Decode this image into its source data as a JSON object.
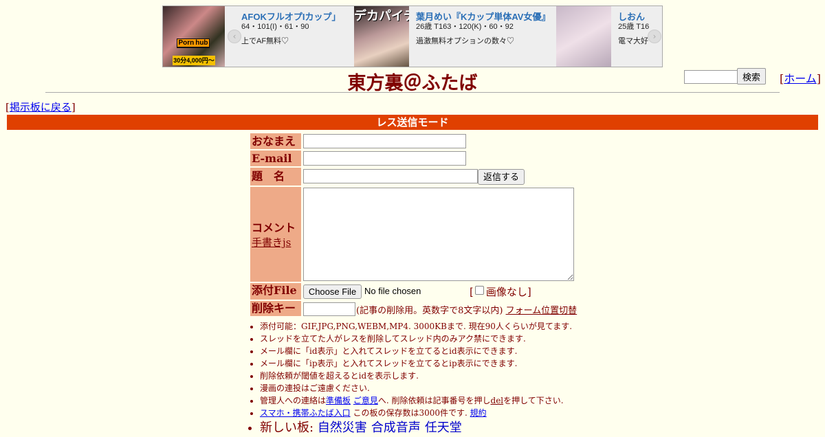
{
  "ad": {
    "left_thumb": {
      "badge": "30分4,000円〜",
      "brand_a": "Porn",
      "brand_b": "hub"
    },
    "prev_label": "‹",
    "next_label": "›",
    "cards": [
      {
        "title": "AFOKフルオプIカップ」",
        "spec": "64・101(I)・61・90",
        "desc": "上でAF無料♡"
      },
      {
        "title": "葉月めい『Kカップ単体AV女優』",
        "spec": "26歳 T163・120(K)・60・92",
        "desc": "過激無料オプションの数々♡"
      },
      {
        "title": "しおん",
        "spec": "25歳 T16",
        "desc": "電マ大好"
      }
    ],
    "mid_thumb_text": "デカパイデカ"
  },
  "header": {
    "logo": "東方裏＠ふたば",
    "search_button": "検索",
    "home_link": "ホーム",
    "back_link": "掲示板に戻る"
  },
  "mode_bar": "レス送信モード",
  "form": {
    "name_label": "おなまえ",
    "email_label": "E-mail",
    "subject_label": "題　名",
    "submit_button": "返信する",
    "comment_label": "コメント",
    "handwrite_link": "手書きjs",
    "file_label": "添付File",
    "file_button": "Choose File",
    "file_status": "No file chosen",
    "no_image_label": "画像なし",
    "delkey_label": "削除キー",
    "delkey_note": "(記事の削除用。英数字で8文字以内)",
    "form_toggle_link": "フォーム位置切替"
  },
  "rules": {
    "r1": "添付可能：GIF,JPG,PNG,WEBM,MP4. 3000KBまで. 現在90人くらいが見てます.",
    "r2": "スレッドを立てた人がレスを削除してスレッド内のみアク禁にできます.",
    "r3": "メール欄に「id表示」と入れてスレッドを立てるとid表示にできます.",
    "r4": "メール欄に「ip表示」と入れてスレッドを立てるとip表示にできます.",
    "r5": "削除依頼が閾値を超えるとidを表示します.",
    "r6": "漫画の連投はご遠慮ください.",
    "r7_a": "管理人への連絡は",
    "r7_link1": "準備板",
    "r7_link2": "ご意見",
    "r7_b": "へ. 削除依頼は記事番号を押し",
    "r7_link3": "del",
    "r7_c": "を押して下さい.",
    "r8_link1": "スマホ・携帯ふたば入口",
    "r8_b": "この板の保存数は3000件です.",
    "r8_link2": "規約",
    "r9_label": "新しい板:",
    "r9_boards": [
      "自然災害",
      "合成音声",
      "任天堂"
    ]
  }
}
